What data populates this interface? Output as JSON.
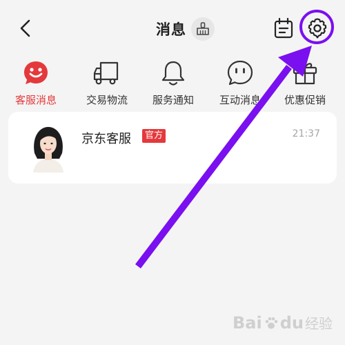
{
  "header": {
    "title": "消息",
    "icons": {
      "back": "chevron-left-icon",
      "clean": "broom-icon",
      "calendar": "calendar-icon",
      "settings": "gear-icon"
    }
  },
  "categories": [
    {
      "label": "客服消息",
      "icon": "customer-service-icon",
      "active": true
    },
    {
      "label": "交易物流",
      "icon": "truck-icon",
      "active": false
    },
    {
      "label": "服务通知",
      "icon": "bell-icon",
      "active": false
    },
    {
      "label": "互动消息",
      "icon": "chat-icon",
      "active": false
    },
    {
      "label": "优惠促销",
      "icon": "gift-icon",
      "active": false
    }
  ],
  "messages": [
    {
      "name": "京东客服",
      "badge": "官方",
      "time": "21:37"
    }
  ],
  "annotation": {
    "color": "#7a0ff0"
  },
  "watermark": {
    "brand_a": "Bai",
    "brand_b": "du",
    "suffix": "经验"
  },
  "colors": {
    "accent": "#e4393c",
    "annotation": "#7a0ff0",
    "background": "#f4f4f4"
  }
}
